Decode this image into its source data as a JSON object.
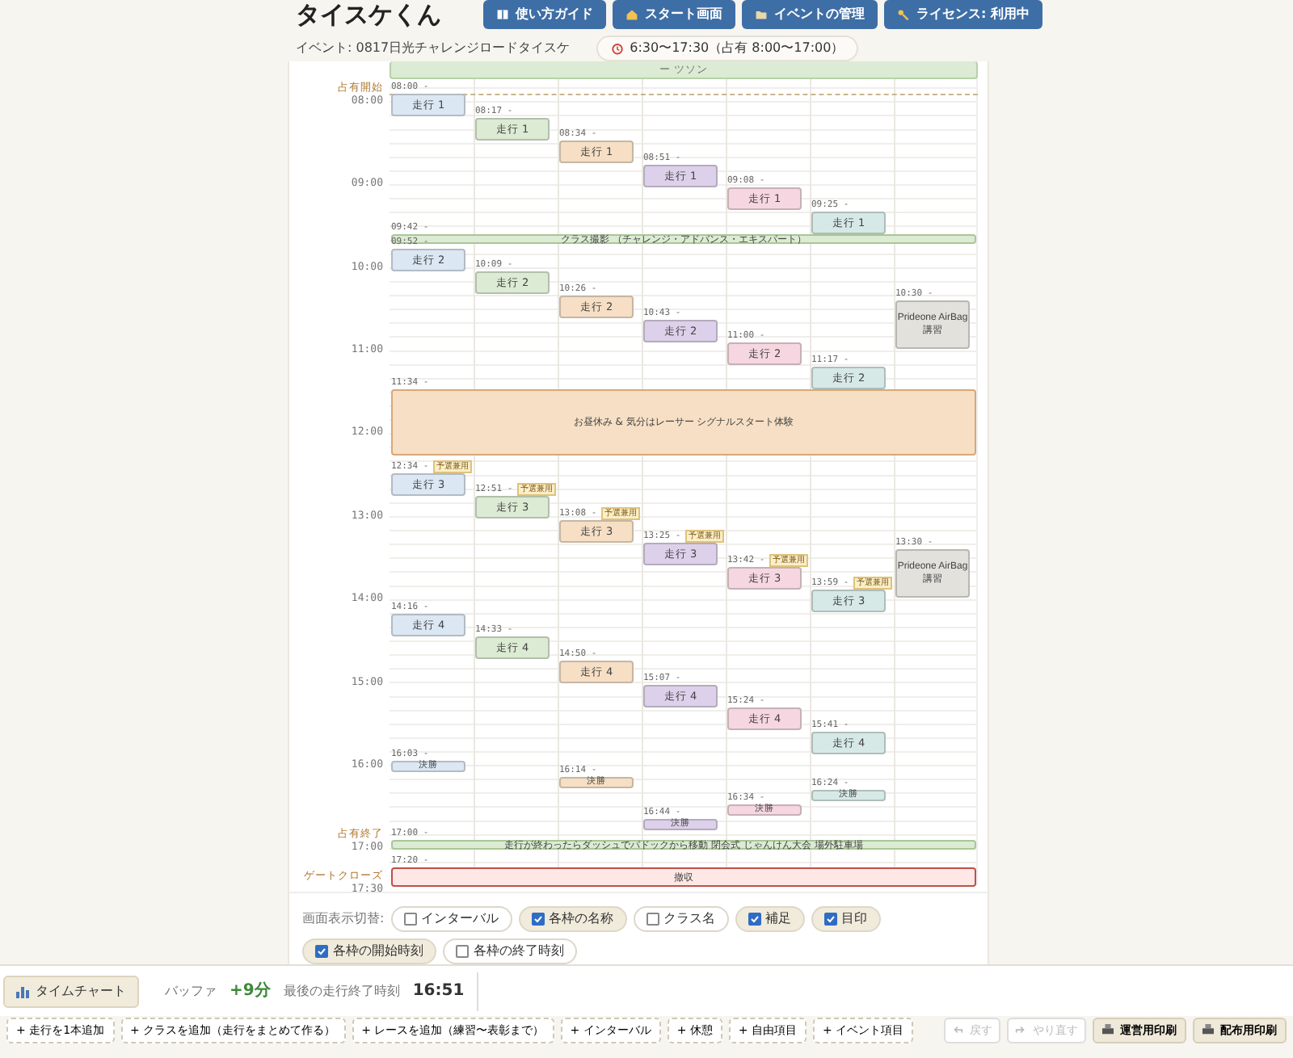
{
  "app_title": "タイスケくん",
  "nav_buttons": [
    {
      "label": "使い方ガイド"
    },
    {
      "label": "スタート画面"
    },
    {
      "label": "イベントの管理"
    },
    {
      "label": "ライセンス: 利用中"
    }
  ],
  "event_label": "イベント: 0817日光チャレンジロードタイスケ",
  "event_hours": "6:30〜17:30（占有 8:00〜17:00）",
  "timetable": {
    "top_band": {
      "label": "ー ツソン"
    },
    "time_axis": [
      {
        "time": "08:00",
        "note": "占有開始"
      },
      {
        "time": "09:00"
      },
      {
        "time": "10:00"
      },
      {
        "time": "11:00"
      },
      {
        "time": "12:00"
      },
      {
        "time": "13:00"
      },
      {
        "time": "14:00"
      },
      {
        "time": "15:00"
      },
      {
        "time": "16:00"
      },
      {
        "time": "17:00",
        "note": "占有終了"
      },
      {
        "time": "17:30",
        "note": "ゲートクローズ"
      }
    ],
    "lanes": [
      {
        "color": "#dbe7f3",
        "items": [
          {
            "start": "08:00 -",
            "label": "走行 1",
            "kind": "run"
          },
          {
            "start": "09:52 -",
            "label": "走行 2",
            "kind": "run"
          },
          {
            "start": "12:34 -",
            "label": "走行 3",
            "kind": "run",
            "tag": "予選兼用"
          },
          {
            "start": "14:16 -",
            "label": "走行 4",
            "kind": "run"
          },
          {
            "start": "16:03 -",
            "label": "決勝",
            "kind": "final"
          }
        ]
      },
      {
        "color": "#dcebd3",
        "items": [
          {
            "start": "08:17 -",
            "label": "走行 1",
            "kind": "run"
          },
          {
            "start": "10:09 -",
            "label": "走行 2",
            "kind": "run"
          },
          {
            "start": "12:51 -",
            "label": "走行 3",
            "kind": "run",
            "tag": "予選兼用"
          },
          {
            "start": "14:33 -",
            "label": "走行 4",
            "kind": "run"
          }
        ]
      },
      {
        "color": "#f6dfc4",
        "items": [
          {
            "start": "08:34 -",
            "label": "走行 1",
            "kind": "run"
          },
          {
            "start": "10:26 -",
            "label": "走行 2",
            "kind": "run"
          },
          {
            "start": "13:08 -",
            "label": "走行 3",
            "kind": "run",
            "tag": "予選兼用"
          },
          {
            "start": "14:50 -",
            "label": "走行 4",
            "kind": "run"
          },
          {
            "start": "16:14 -",
            "label": "決勝",
            "kind": "final"
          }
        ]
      },
      {
        "color": "#ddd0ea",
        "items": [
          {
            "start": "08:51 -",
            "label": "走行 1",
            "kind": "run"
          },
          {
            "start": "10:43 -",
            "label": "走行 2",
            "kind": "run"
          },
          {
            "start": "13:25 -",
            "label": "走行 3",
            "kind": "run",
            "tag": "予選兼用"
          },
          {
            "start": "15:07 -",
            "label": "走行 4",
            "kind": "run"
          },
          {
            "start": "16:44 -",
            "label": "決勝",
            "kind": "final"
          }
        ]
      },
      {
        "color": "#f6d7e1",
        "items": [
          {
            "start": "09:08 -",
            "label": "走行 1",
            "kind": "run"
          },
          {
            "start": "11:00 -",
            "label": "走行 2",
            "kind": "run"
          },
          {
            "start": "13:42 -",
            "label": "走行 3",
            "kind": "run",
            "tag": "予選兼用"
          },
          {
            "start": "15:24 -",
            "label": "走行 4",
            "kind": "run"
          },
          {
            "start": "16:34 -",
            "label": "決勝",
            "kind": "final"
          }
        ]
      },
      {
        "color": "#d6e9e6",
        "items": [
          {
            "start": "09:25 -",
            "label": "走行 1",
            "kind": "run"
          },
          {
            "start": "11:17 -",
            "label": "走行 2",
            "kind": "run"
          },
          {
            "start": "13:59 -",
            "label": "走行 3",
            "kind": "run",
            "tag": "予選兼用"
          },
          {
            "start": "15:41 -",
            "label": "走行 4",
            "kind": "run"
          },
          {
            "start": "16:24 -",
            "label": "決勝",
            "kind": "final"
          }
        ]
      },
      {
        "color": "#e3e1dc",
        "items": [
          {
            "start": "10:30 -",
            "label": "Prideone AirBag講習",
            "kind": "lecture"
          },
          {
            "start": "13:30 -",
            "label": "Prideone AirBag講習",
            "kind": "lecture"
          }
        ]
      }
    ],
    "wide_items": [
      {
        "start": "09:42 -",
        "label": "クラス撮影 （チャレンジ・アドバンス・エキスパート）",
        "kind": "band"
      },
      {
        "start": "11:34 -",
        "label": "お昼休み & 気分はレーサー シグナルスタート体験",
        "kind": "break"
      },
      {
        "start": "17:00 -",
        "label": "走行が終わったらダッシュでパドックから移動 閉会式 じゃんけん大会 場外駐車場",
        "kind": "band"
      },
      {
        "start": "17:20 -",
        "label": "撤収",
        "kind": "closure"
      }
    ]
  },
  "display_toggles_label": "画面表示切替:",
  "display_toggles": [
    {
      "label": "インターバル",
      "checked": false
    },
    {
      "label": "各枠の名称",
      "checked": true
    },
    {
      "label": "クラス名",
      "checked": false
    },
    {
      "label": "補足",
      "checked": true
    },
    {
      "label": "目印",
      "checked": true
    },
    {
      "label": "各枠の開始時刻",
      "checked": true
    },
    {
      "label": "各枠の終了時刻",
      "checked": false
    }
  ],
  "status": {
    "chart_button": "タイムチャート",
    "buffer_label": "バッファ",
    "buffer_value": "+9分",
    "last_end_label": "最後の走行終了時刻",
    "last_end_value": "16:51"
  },
  "add_buttons": [
    "+ 走行を1本追加",
    "+ クラスを追加（走行をまとめて作る）",
    "+ レースを追加（練習〜表彰まで）",
    "+ インターバル",
    "+ 休憩",
    "+ 自由項目",
    "+ イベント項目"
  ],
  "history_buttons": [
    {
      "label": "戻す",
      "disabled": true
    },
    {
      "label": "やり直す",
      "disabled": true
    }
  ],
  "print_buttons": [
    "運営用印刷",
    "配布用印刷"
  ]
}
